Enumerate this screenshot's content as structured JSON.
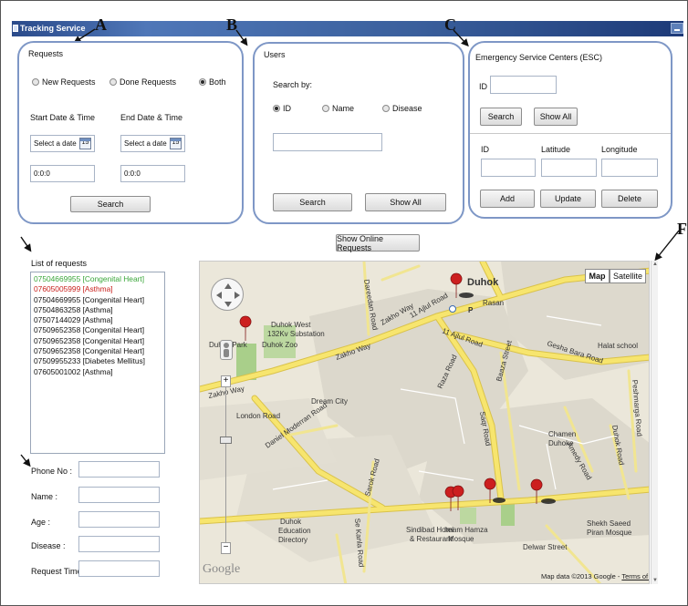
{
  "window": {
    "title": "Tracking Service"
  },
  "marks": {
    "a": "A",
    "b": "B",
    "c": "C",
    "f": "F"
  },
  "requests_panel": {
    "title": "Requests",
    "radio_new": "New Requests",
    "radio_done": "Done Requests",
    "radio_both": "Both",
    "selected": "Both",
    "start_label": "Start Date & Time",
    "end_label": "End Date & Time",
    "start_date": "Select a date",
    "end_date": "Select a date",
    "calendar_day": "15",
    "start_time": "0:0:0",
    "end_time": "0:0:0",
    "search_label": "Search"
  },
  "users_panel": {
    "title": "Users",
    "search_by": "Search by:",
    "radio_id": "ID",
    "radio_name": "Name",
    "radio_disease": "Disease",
    "selected": "ID",
    "search_value": "",
    "search_label": "Search",
    "show_all_label": "Show All"
  },
  "esc_panel": {
    "title": "Emergency Service Centers (ESC)",
    "id_label": "ID",
    "id_value": "",
    "search_label": "Search",
    "show_all_label": "Show All",
    "col_id": "ID",
    "col_lat": "Latitude",
    "col_lon": "Longitude",
    "add_label": "Add",
    "update_label": "Update",
    "delete_label": "Delete"
  },
  "show_online_label": "Show Online Requests",
  "list": {
    "title": "List of requests",
    "items": [
      {
        "text": "07504669955 [Congenital Heart]",
        "color": "#3aa63a"
      },
      {
        "text": "07605005999 [Asthma]",
        "color": "#c8201c"
      },
      {
        "text": "07504669955 [Congenital Heart]",
        "color": "#111111"
      },
      {
        "text": "07504863258 [Asthma]",
        "color": "#111111"
      },
      {
        "text": "07507144029 [Asthma]",
        "color": "#111111"
      },
      {
        "text": "07509652358 [Congenital Heart]",
        "color": "#111111"
      },
      {
        "text": "07509652358 [Congenital Heart]",
        "color": "#111111"
      },
      {
        "text": "07509652358 [Congenital Heart]",
        "color": "#111111"
      },
      {
        "text": "07509955233 [Diabetes Mellitus]",
        "color": "#111111"
      },
      {
        "text": "07605001002 [Asthma]",
        "color": "#111111"
      }
    ]
  },
  "details": {
    "phone_label": "Phone No :",
    "name_label": "Name :",
    "age_label": "Age :",
    "disease_label": "Disease :",
    "time_label": "Request Time :"
  },
  "map": {
    "type_map": "Map",
    "type_satellite": "Satellite",
    "google": "Google",
    "attribution": "Map data ©2013 Google - ",
    "terms": "Terms of Use",
    "labels": {
      "duhok": "Duhok",
      "rasan": "Rasan",
      "duhok_west": "Duhok West",
      "substation": "132Kv Substation",
      "duhok_zoo": "Duhok Zoo",
      "duhok_park": "Duhok Park",
      "dream_city": "Dream City",
      "zakho_way": "Zakho Way",
      "zakho_way2": "Zakho Way",
      "zakho_way3": "Zakho Way",
      "ajlul_road": "11 Ajlul Road",
      "ajlul_road2": "11 Ajlul Road",
      "raza_road": "Raza Road",
      "baaza_street": "Baaza Street",
      "gesha_bara": "Gesha Bara Road",
      "halat_school": "Halat school",
      "chamen_duhoke": "Chamen",
      "chamen_duhoke2": "Duhoke",
      "london_road": "London Road",
      "daniel_road": "Daniel Moderran Road",
      "dareedan_road": "Dareedan Road",
      "saqr_road": "Saqr Road",
      "sarok_road": "Sarok Road",
      "se_kanla": "Se Kanla Road",
      "sindibad": "Sindibad Hotel",
      "restaurant": "& Restaurant",
      "imam_hamza": "Imam Hamza",
      "mosque": "Mosque",
      "education1": "Duhok",
      "education2": "Education",
      "education3": "Directory",
      "sheikh1": "Shekh Saeed",
      "sheikh2": "Piran Mosque",
      "delwar": "Delwar Street",
      "amedy_road": "Amedy Road",
      "duhok_road": "Duhok Road",
      "peshmarga": "Peshmarga Road",
      "p": "P"
    }
  },
  "colors": {
    "panel_border": "#7e97c6",
    "road": "#f5e36a",
    "road_edge": "#d9c24a",
    "block": "#d6d2c6",
    "green": "#b9d59a",
    "marker": "#cc1f1f"
  }
}
